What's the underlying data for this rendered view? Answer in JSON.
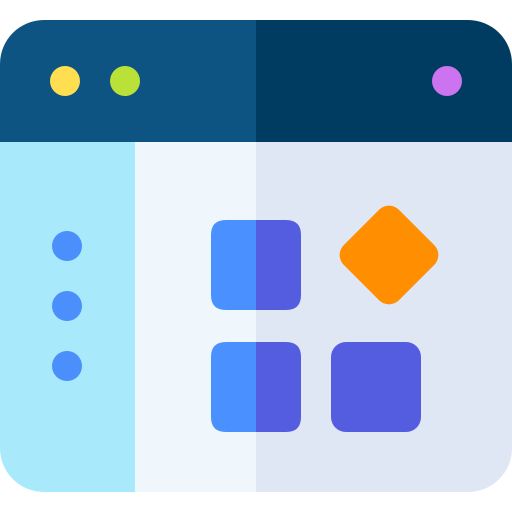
{
  "icon": {
    "name": "app-window-grid-icon",
    "palette": {
      "titlebar_left": "#0e5482",
      "titlebar_right": "#003b61",
      "sidebar": "#a8eafb",
      "content_left": "#eff7fd",
      "content_right": "#dfe6f4",
      "control_yellow": "#ffde51",
      "control_green": "#b9e138",
      "control_purple": "#cc73f0",
      "sidebar_dot": "#4a8ffb",
      "tile_blue": "#4a90ff",
      "tile_indigo": "#545de0",
      "diamond_orange": "#ff8e00"
    }
  }
}
